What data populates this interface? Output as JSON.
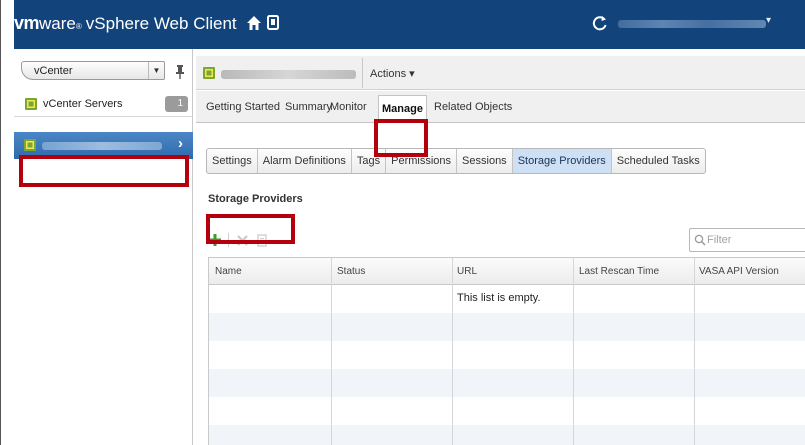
{
  "header": {
    "brand_vm": "vm",
    "brand_ware": "ware",
    "brand_reg": "®",
    "product": "vSphere Web Client",
    "user_caret": "▾"
  },
  "navigator": {
    "breadcrumb": "vCenter",
    "vcenter_servers_label": "vCenter Servers",
    "vcenter_servers_count": "1",
    "selected_chevron": "›"
  },
  "object_header": {
    "actions_label": "Actions ▾"
  },
  "tabs": [
    {
      "label": "Getting Started"
    },
    {
      "label": "Summary"
    },
    {
      "label": "Monitor"
    },
    {
      "label": "Manage"
    },
    {
      "label": "Related Objects"
    }
  ],
  "subtabs": [
    {
      "label": "Settings"
    },
    {
      "label": "Alarm Definitions"
    },
    {
      "label": "Tags"
    },
    {
      "label": "Permissions"
    },
    {
      "label": "Sessions"
    },
    {
      "label": "Storage Providers"
    },
    {
      "label": "Scheduled Tasks"
    }
  ],
  "section": {
    "title": "Storage Providers",
    "filter_placeholder": "Filter"
  },
  "grid": {
    "columns": [
      "Name",
      "Status",
      "URL",
      "Last Rescan Time",
      "VASA API Version"
    ],
    "empty_message": "This list is empty."
  },
  "colors": {
    "header_bg": "#12437a",
    "selection_blue": "#2f6aad",
    "highlight_red": "#b3000c",
    "add_green": "#3a9a2a"
  }
}
